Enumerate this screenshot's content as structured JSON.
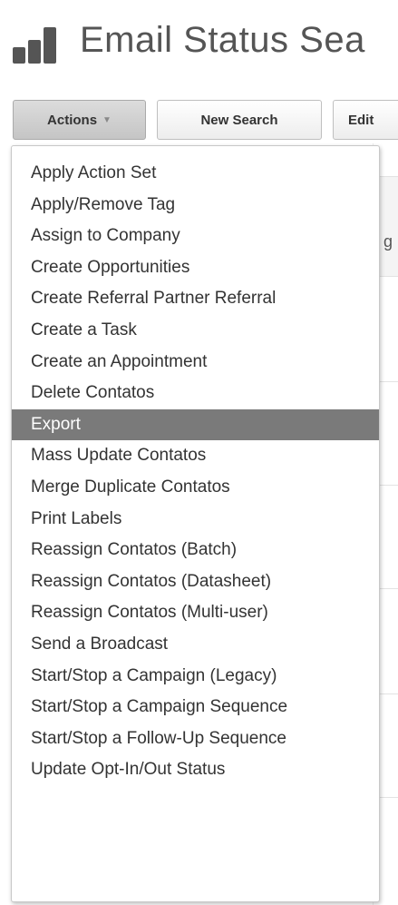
{
  "header": {
    "title": "Email Status Sea"
  },
  "toolbar": {
    "actions_label": "Actions",
    "actions_caret": "▼",
    "new_search_label": "New Search",
    "edit_label": "Edit"
  },
  "background": {
    "partial_text": "g"
  },
  "menu": {
    "items": [
      {
        "label": "Apply Action Set"
      },
      {
        "label": "Apply/Remove Tag"
      },
      {
        "label": "Assign to Company"
      },
      {
        "label": "Create Opportunities"
      },
      {
        "label": "Create Referral Partner Referral"
      },
      {
        "label": "Create a Task"
      },
      {
        "label": "Create an Appointment"
      },
      {
        "label": "Delete Contatos"
      },
      {
        "label": "Export",
        "highlighted": true
      },
      {
        "label": "Mass Update Contatos"
      },
      {
        "label": "Merge Duplicate Contatos"
      },
      {
        "label": "Print Labels"
      },
      {
        "label": "Reassign Contatos (Batch)"
      },
      {
        "label": "Reassign Contatos (Datasheet)"
      },
      {
        "label": "Reassign Contatos (Multi-user)"
      },
      {
        "label": "Send a Broadcast"
      },
      {
        "label": "Start/Stop a Campaign (Legacy)"
      },
      {
        "label": "Start/Stop a Campaign Sequence"
      },
      {
        "label": "Start/Stop a Follow-Up Sequence"
      },
      {
        "label": "Update Opt-In/Out Status"
      }
    ]
  },
  "colors": {
    "highlight": "#7a7a7a",
    "text": "#333333",
    "logo": "#555555"
  },
  "icons": {
    "logo": "bar-chart-icon",
    "caret": "caret-down-icon"
  }
}
